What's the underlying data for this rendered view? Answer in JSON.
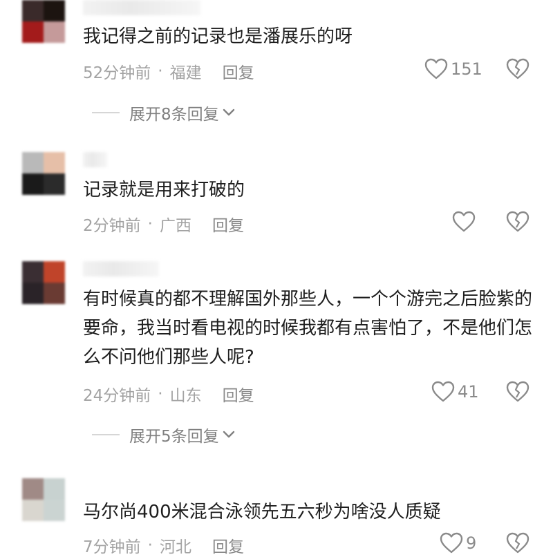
{
  "comments": [
    {
      "text": "我记得之前的记录也是潘展乐的呀",
      "time": "52分钟前",
      "location": "福建",
      "reply_label": "回复",
      "likes": "151",
      "expand_label": "展开8条回复",
      "avatar_colors": [
        "#3a2a2a",
        "#1c1410",
        "#a31b1b",
        "#c59a9a"
      ]
    },
    {
      "text": "记录就是用来打破的",
      "time": "2分钟前",
      "location": "广西",
      "reply_label": "回复",
      "likes": "",
      "avatar_colors": [
        "#b9b9b9",
        "#e6bfa8",
        "#1a1a1a",
        "#2b2b2b"
      ]
    },
    {
      "text": "有时候真的都不理解国外那些人，一个个游完之后脸紫的要命，我当时看电视的时候我都有点害怕了，不是他们怎么不问他们那些人呢?",
      "time": "24分钟前",
      "location": "山东",
      "reply_label": "回复",
      "likes": "41",
      "expand_label": "展开5条回复",
      "avatar_colors": [
        "#3a2e33",
        "#c0442a",
        "#2a2328",
        "#6a3b33"
      ]
    },
    {
      "text": "马尔尚400米混合泳领先五六秒为啥没人质疑",
      "time": "7分钟前",
      "location": "河北",
      "reply_label": "回复",
      "likes": "9",
      "avatar_colors": [
        "#a08a86",
        "#c8d2d0",
        "#d9d6cf",
        "#cbd4d2"
      ]
    }
  ],
  "icons": {
    "like": "heart-outline-icon",
    "dislike": "broken-heart-icon",
    "expand": "chevron-down-icon"
  }
}
